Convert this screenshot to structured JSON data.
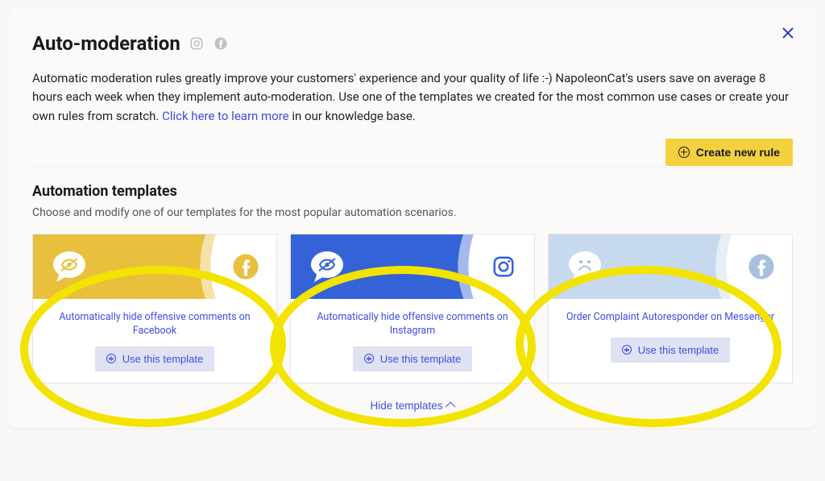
{
  "header": {
    "title": "Auto-moderation",
    "close_aria": "Close"
  },
  "description": {
    "text_before": "Automatic moderation rules greatly improve your customers' experience and your quality of life :-) NapoleonCat's users save on average 8 hours each week when they implement auto-moderation. Use one of the templates we created for the most common use cases or create your own rules from scratch. ",
    "link_text": "Click here to learn more",
    "text_after": " in our knowledge base."
  },
  "actions": {
    "create_rule_label": "Create new rule"
  },
  "templates_section": {
    "title": "Automation templates",
    "subtitle": "Choose and modify one of our templates for the most popular automation scenarios.",
    "use_template_label": "Use this template",
    "hide_label": "Hide templates"
  },
  "templates": [
    {
      "label": "Automatically hide offensive comments on Facebook",
      "banner_color": "yellow",
      "platform_icon": "facebook",
      "main_icon": "hide-comment"
    },
    {
      "label": "Automatically hide offensive comments on Instagram",
      "banner_color": "blue",
      "platform_icon": "instagram",
      "main_icon": "hide-comment"
    },
    {
      "label": "Order Complaint Autoresponder on Messenger",
      "banner_color": "light",
      "platform_icon": "facebook",
      "main_icon": "sad-face"
    }
  ]
}
